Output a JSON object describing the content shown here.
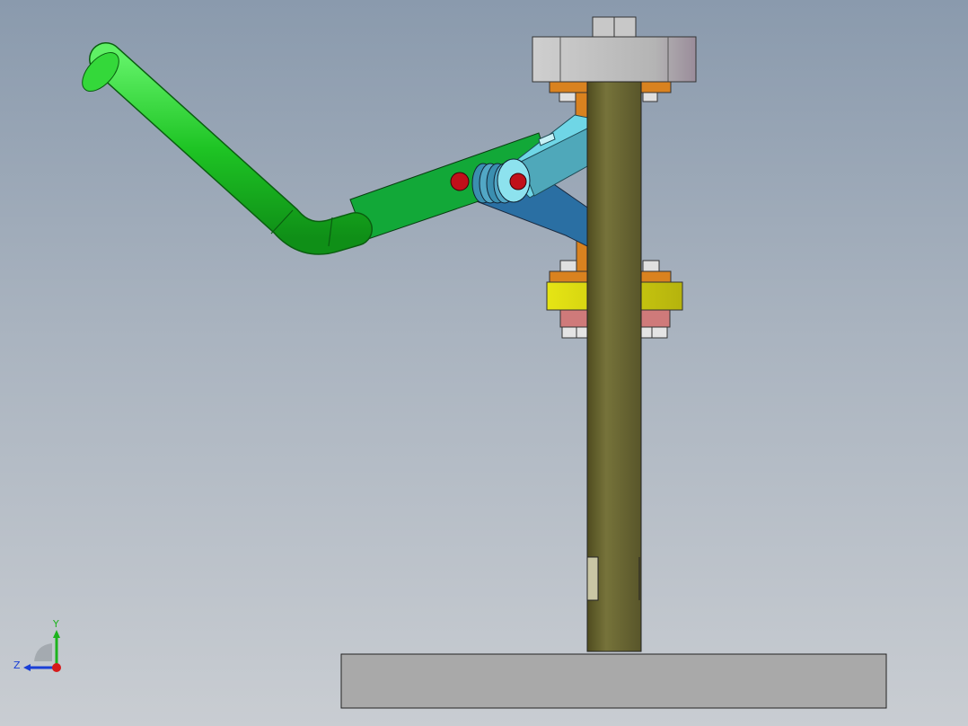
{
  "viewport": {
    "name": "CAD 3D viewport",
    "background_top": "#8a9aad",
    "background_bottom": "#c9cdd2"
  },
  "triad": {
    "y_label": "Y",
    "z_label": "Z",
    "y_color": "#1db31d",
    "z_color": "#1a3fd6",
    "x_color": "#d61a1a"
  },
  "colors": {
    "handle_green": "#19c21e",
    "lever_green": "#12a838",
    "link_light_blue": "#62c8d8",
    "link_dark_blue": "#2a6fa3",
    "spring_blue": "#3b8fb0",
    "pin_red": "#c0101a",
    "rod_olive": "#6d6a2f",
    "block_grey": "#bcbcbc",
    "collar_yellow": "#d8d70f",
    "bracket_orange": "#d9821f",
    "ring_pink": "#cf7a7a",
    "base_grey": "#a8a8a8"
  },
  "parts": [
    "handle-grip",
    "lever-arm",
    "link-upper",
    "link-lower",
    "pivot-pin",
    "spring-stack",
    "plunger-rod",
    "top-block",
    "top-nut",
    "upper-bracket",
    "lower-bracket",
    "guide-collar",
    "clamp-ring",
    "base-plate"
  ]
}
